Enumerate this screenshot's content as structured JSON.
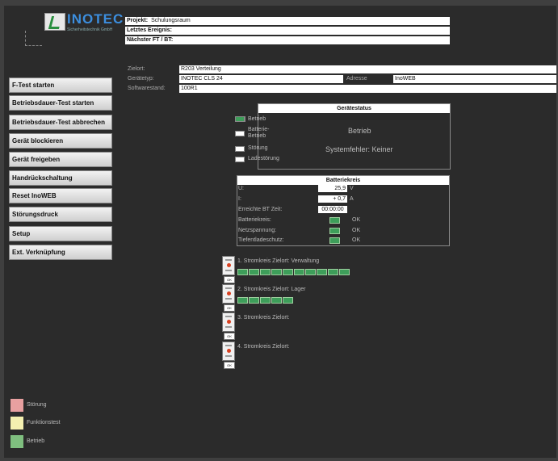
{
  "brand": {
    "name": "INOTEC",
    "subtitle": "Sicherheitstechnik GmbH"
  },
  "header": {
    "projekt_label": "Projekt:",
    "projekt_value": "Schulungsraum",
    "letztes_ereignis_label": "Letztes Ereignis:",
    "letztes_ereignis_value": "",
    "naechster_label": "Nächster FT / BT:",
    "naechster_value": ""
  },
  "device": {
    "zielort_label": "Zielort:",
    "zielort_value": "R203 Verteilung",
    "geraetetyp_label": "Gerätetyp:",
    "geraetetyp_value": "INOTEC CLS 24",
    "adresse_label": "Adresse",
    "adresse_value": "InoWEB",
    "software_label": "Softwarestand:",
    "software_value": "100R1"
  },
  "sidebar": {
    "buttons": [
      "F-Test starten",
      "Betriebsdauer-Test starten",
      "Betriebsdauer-Test abbrechen",
      "Gerät blockieren",
      "Gerät freigeben",
      "Handrückschaltung",
      "Reset InoWEB",
      "Störungsdruck",
      "Setup",
      "Ext. Verknüpfung"
    ]
  },
  "geraetestatus": {
    "title": "Gerätestatus",
    "rows": [
      {
        "label": "Betrieb",
        "color": "#3e9e5a"
      },
      {
        "label": "Batterie-\nBetrieb",
        "color": "#ffffff"
      },
      {
        "label": "Störung",
        "color": "#ffffff"
      },
      {
        "label": "Ladestörung",
        "color": "#ffffff"
      }
    ],
    "status_text": "Betrieb",
    "error_text": "Systemfehler: Keiner"
  },
  "batteriekreis": {
    "title": "Batteriekreis",
    "u_label": "U:",
    "u_value": "25,9",
    "u_unit": "V",
    "i_label": "I:",
    "i_value": "+ 0,7",
    "i_unit": "A",
    "bt_label": "Erreichte BT Zeit:",
    "bt_value": "00:00:00",
    "status_rows": [
      {
        "label": "Batteriekreis:",
        "value": "OK"
      },
      {
        "label": "Netzspannung:",
        "value": "OK"
      },
      {
        "label": "Tiefentladeschutz:",
        "value": "OK"
      }
    ]
  },
  "stromkreise": [
    {
      "title": "1. Stromkreis Zielort: Verwaltung",
      "lamps": 10,
      "ok_label": "OK"
    },
    {
      "title": "2. Stromkreis Zielort: Lager",
      "lamps": 5,
      "ok_label": "OK"
    },
    {
      "title": "3. Stromkreis Zielort:",
      "lamps": 0,
      "ok_label": "OK"
    },
    {
      "title": "4. Stromkreis Zielort:",
      "lamps": 0,
      "ok_label": "OK"
    }
  ],
  "legend": [
    {
      "label": "Störung",
      "color": "#e8a0a0"
    },
    {
      "label": "Funktionstest",
      "color": "#f4f0b0"
    },
    {
      "label": "Betrieb",
      "color": "#7fbf7f"
    }
  ]
}
